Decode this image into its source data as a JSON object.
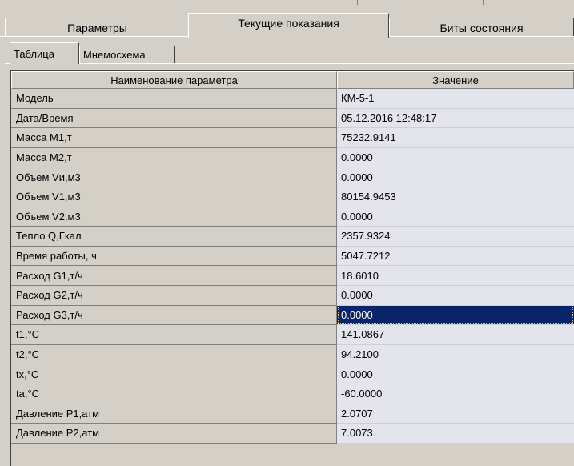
{
  "top_tabs": [
    {
      "label": "Параметры",
      "active": false
    },
    {
      "label": "Текущие показания",
      "active": true
    },
    {
      "label": "Биты состояния",
      "active": false
    }
  ],
  "inner_tabs": [
    {
      "label": "Таблица",
      "active": true
    },
    {
      "label": "Мнемосхема",
      "active": false
    }
  ],
  "table": {
    "columns": [
      "Наименование параметра",
      "Значение"
    ],
    "rows": [
      {
        "name": "Модель",
        "value": "КМ-5-1"
      },
      {
        "name": "Дата/Время",
        "value": "05.12.2016 12:48:17"
      },
      {
        "name": "Масса М1,т",
        "value": "75232.9141"
      },
      {
        "name": "Масса М2,т",
        "value": "0.0000"
      },
      {
        "name": "Объем Vи,м3",
        "value": "0.0000"
      },
      {
        "name": "Объем V1,м3",
        "value": "80154.9453"
      },
      {
        "name": "Объем V2,м3",
        "value": "0.0000"
      },
      {
        "name": "Тепло Q,Гкал",
        "value": "2357.9324"
      },
      {
        "name": "Время работы, ч",
        "value": "5047.7212"
      },
      {
        "name": "Расход G1,т/ч",
        "value": "18.6010"
      },
      {
        "name": "Расход G2,т/ч",
        "value": "0.0000"
      },
      {
        "name": "Расход G3,т/ч",
        "value": "0.0000",
        "selected": true
      },
      {
        "name": "t1,°C",
        "value": "141.0867"
      },
      {
        "name": "t2,°C",
        "value": "94.2100"
      },
      {
        "name": "tx,°C",
        "value": "0.0000"
      },
      {
        "name": "ta,°C",
        "value": "-60.0000"
      },
      {
        "name": "Давление P1,атм",
        "value": "2.0707"
      },
      {
        "name": "Давление P2,атм",
        "value": "7.0073"
      }
    ]
  },
  "colors": {
    "face": "#d4d0c8",
    "value_bg": "#e4e4ec",
    "selection": "#0a246a"
  }
}
